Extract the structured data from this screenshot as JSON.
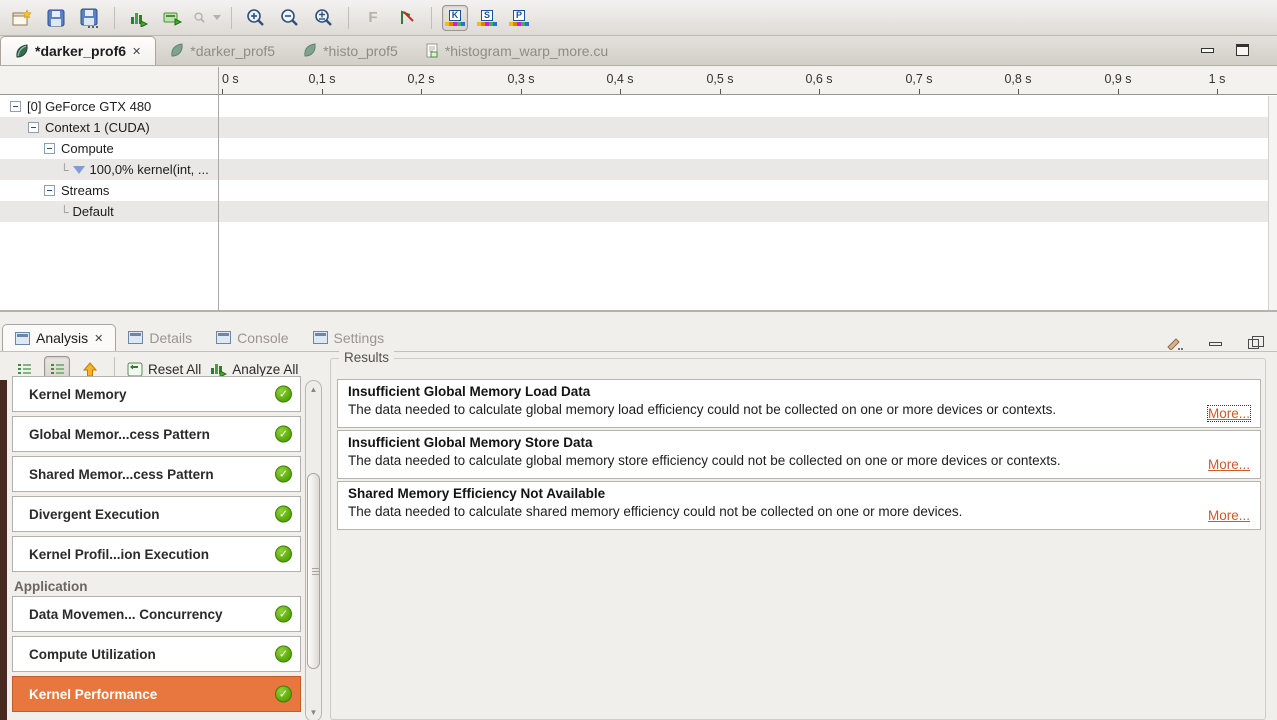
{
  "toolbar": {
    "letter_f": "F",
    "segment_buttons": [
      {
        "letter": "K",
        "pressed": true
      },
      {
        "letter": "S",
        "pressed": false
      },
      {
        "letter": "P",
        "pressed": false
      }
    ]
  },
  "tabs": [
    {
      "label": "*darker_prof6",
      "icon": "session-leaf",
      "active": true,
      "closable": true
    },
    {
      "label": "*darker_prof5",
      "icon": "session-leaf",
      "active": false
    },
    {
      "label": "*histo_prof5",
      "icon": "session-leaf",
      "active": false
    },
    {
      "label": "*histogram_warp_more.cu",
      "icon": "source-file",
      "active": false
    }
  ],
  "timeline": {
    "ruler": [
      "0 s",
      "0,1 s",
      "0,2 s",
      "0,3 s",
      "0,4 s",
      "0,5 s",
      "0,6 s",
      "0,7 s",
      "0,8 s",
      "0,9 s",
      "1 s"
    ],
    "tree": [
      {
        "label": "[0] GeForce GTX 480",
        "level": 0,
        "expander": true
      },
      {
        "label": "Context 1 (CUDA)",
        "level": 1,
        "expander": true
      },
      {
        "label": "Compute",
        "level": 2,
        "expander": true
      },
      {
        "label": "100,0% kernel(int, ...",
        "level": 3,
        "icon": "filter-funnel"
      },
      {
        "label": "Streams",
        "level": 2,
        "expander": true
      },
      {
        "label": "Default",
        "level": 3
      }
    ]
  },
  "bottom_tabs": [
    {
      "label": "Analysis",
      "active": true,
      "closable": true
    },
    {
      "label": "Details",
      "active": false
    },
    {
      "label": "Console",
      "active": false
    },
    {
      "label": "Settings",
      "active": false
    }
  ],
  "analysis": {
    "reset_all_label": "Reset All",
    "analyze_all_label": "Analyze All",
    "items": [
      {
        "type": "card",
        "label": "Kernel Memory",
        "status": "pass"
      },
      {
        "type": "card",
        "label": "Global Memor...cess Pattern",
        "status": "pass"
      },
      {
        "type": "card",
        "label": "Shared Memor...cess Pattern",
        "status": "pass"
      },
      {
        "type": "card",
        "label": "Divergent Execution",
        "status": "pass"
      },
      {
        "type": "card",
        "label": "Kernel Profil...ion Execution",
        "status": "pass"
      },
      {
        "type": "header",
        "label": "Application"
      },
      {
        "type": "card",
        "label": "Data Movemen... Concurrency",
        "status": "pass"
      },
      {
        "type": "card",
        "label": "Compute Utilization",
        "status": "pass"
      },
      {
        "type": "card",
        "label": "Kernel Performance",
        "status": "pass",
        "selected": true
      }
    ]
  },
  "results": {
    "label": "Results",
    "more_label": "More...",
    "entries": [
      {
        "title": "Insufficient Global Memory Load Data",
        "description": "The data needed to calculate global memory load efficiency could not be collected on one or more devices or contexts."
      },
      {
        "title": "Insufficient Global Memory Store Data",
        "description": "The data needed to calculate global memory store efficiency could not be collected on one or more devices or contexts."
      },
      {
        "title": "Shared Memory Efficiency Not Available",
        "description": "The data needed to calculate shared memory efficiency could not be collected on one or more devices."
      }
    ]
  },
  "colors": {
    "selection_orange": "#e8763f",
    "check_green": "#57a706",
    "link_orange": "#cd5a29"
  }
}
